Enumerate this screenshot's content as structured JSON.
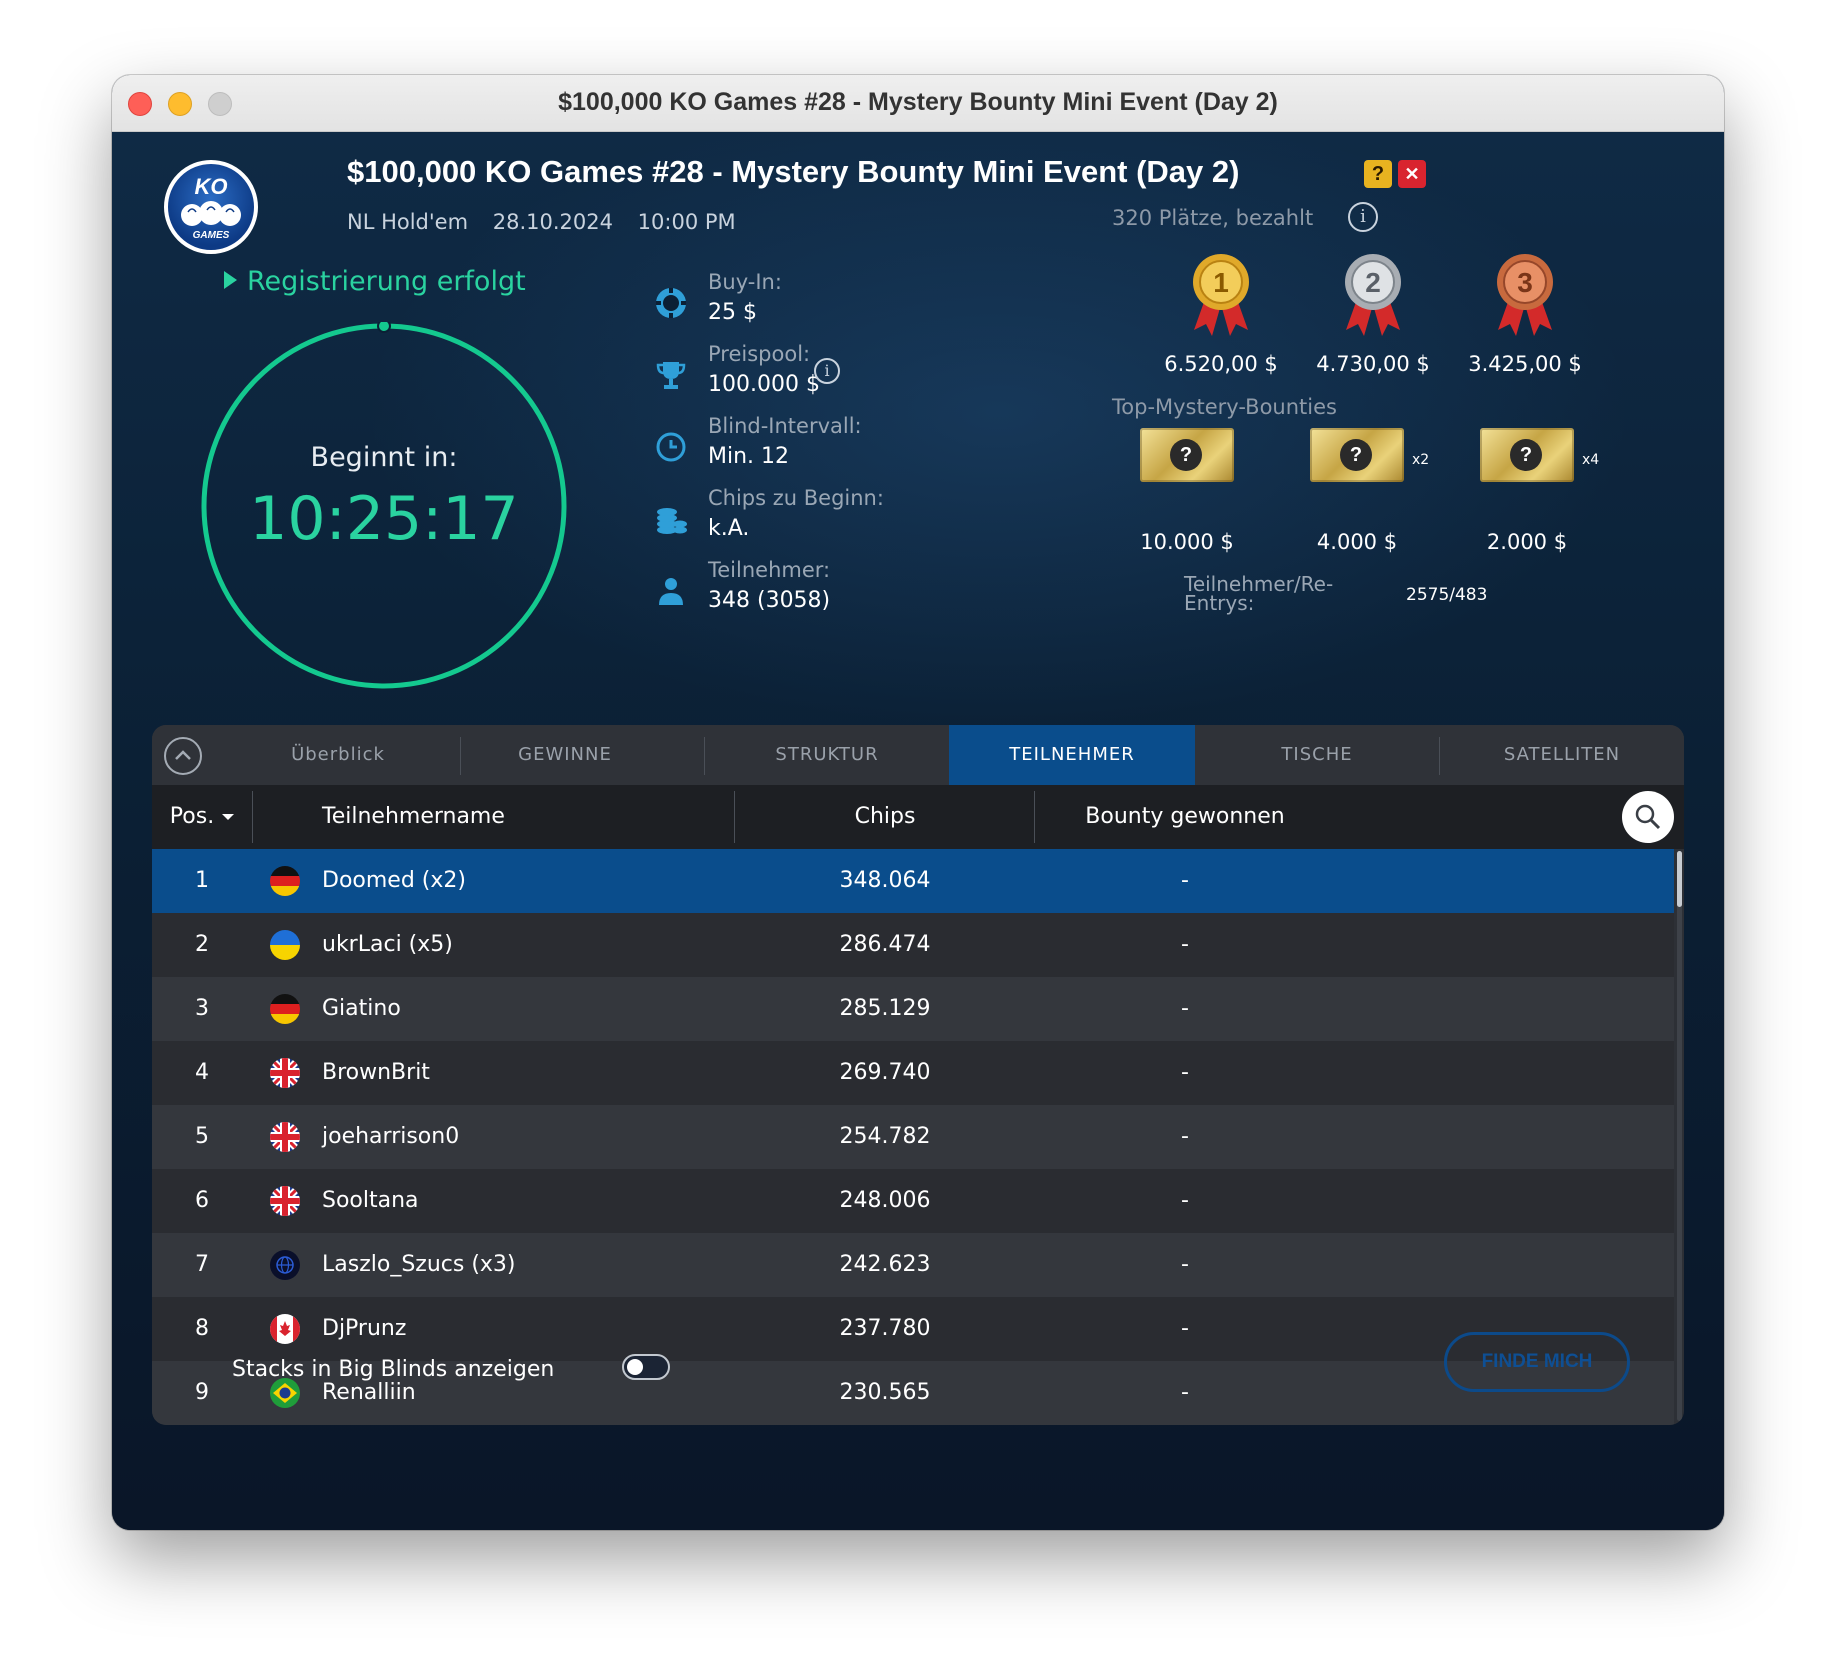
{
  "window": {
    "title": "$100,000 KO Games #28 - Mystery Bounty Mini Event (Day 2)"
  },
  "header": {
    "logo_text": "KO",
    "logo_subtext": "GAMES",
    "event_title": "$100,000 KO Games #28 - Mystery Bounty Mini Event (Day 2)",
    "badge_mystery": "?",
    "badge_ko": "✕",
    "game_type": "NL Hold'em",
    "date": "28.10.2024",
    "time": "10:00 PM",
    "places_paid": "320 Plätze, bezahlt"
  },
  "registration": {
    "status": "Registrierung erfolgt"
  },
  "timer": {
    "label": "Beginnt in:",
    "countdown": "10:25:17"
  },
  "info": {
    "buyin_label": "Buy-In:",
    "buyin_value": "25 $",
    "prizepool_label": "Preispool:",
    "prizepool_value": "100.000 $",
    "blind_label": "Blind-Intervall:",
    "blind_value": "Min. 12",
    "chips_label": "Chips zu Beginn:",
    "chips_value": "k.A.",
    "players_label": "Teilnehmer:",
    "players_value": "348 (3058)"
  },
  "prizes": {
    "medal_1": "1",
    "medal_2": "2",
    "medal_3": "3",
    "first": "6.520,00 $",
    "second": "4.730,00 $",
    "third": "3.425,00 $"
  },
  "bounties": {
    "label": "Top-Mystery-Bounties",
    "ticket_symbol": "?",
    "b1": "10.000 $",
    "b2": "4.000 $",
    "b2_mult": "x2",
    "b3": "2.000 $",
    "b3_mult": "x4"
  },
  "reentries": {
    "label": "Teilnehmer/Re-Entrys:",
    "value": "2575/483"
  },
  "tabs": [
    {
      "label": "Überblick"
    },
    {
      "label": "GEWINNE"
    },
    {
      "label": "STRUKTUR"
    },
    {
      "label": "TEILNEHMER"
    },
    {
      "label": "TISCHE"
    },
    {
      "label": "SATELLITEN"
    }
  ],
  "table": {
    "headers": {
      "pos": "Pos.",
      "name": "Teilnehmername",
      "chips": "Chips",
      "bounty": "Bounty gewonnen"
    },
    "rows": [
      {
        "pos": "1",
        "flag": "germany-flag",
        "name": "Doomed (x2)",
        "chips": "348.064",
        "bounty": "-"
      },
      {
        "pos": "2",
        "flag": "ukraine-flag",
        "name": "ukrLaci (x5)",
        "chips": "286.474",
        "bounty": "-"
      },
      {
        "pos": "3",
        "flag": "germany-flag",
        "name": "Giatino",
        "chips": "285.129",
        "bounty": "-"
      },
      {
        "pos": "4",
        "flag": "uk-flag",
        "name": "BrownBrit",
        "chips": "269.740",
        "bounty": "-"
      },
      {
        "pos": "5",
        "flag": "uk-flag",
        "name": "joeharrison0",
        "chips": "254.782",
        "bounty": "-"
      },
      {
        "pos": "6",
        "flag": "uk-flag",
        "name": "Sooltana",
        "chips": "248.006",
        "bounty": "-"
      },
      {
        "pos": "7",
        "flag": "world-flag",
        "name": "Laszlo_Szucs (x3)",
        "chips": "242.623",
        "bounty": "-"
      },
      {
        "pos": "8",
        "flag": "canada-flag",
        "name": "DjPrunz",
        "chips": "237.780",
        "bounty": "-"
      },
      {
        "pos": "9",
        "flag": "brazil-flag",
        "name": "Renalliin",
        "chips": "230.565",
        "bounty": "-"
      }
    ]
  },
  "footer": {
    "stacks_label": "Stacks in Big Blinds anzeigen",
    "stacks_toggle_on": false,
    "find_me": "FINDE MICH"
  },
  "colors": {
    "accent_green": "#2ad3a0",
    "active_tab": "#0a4d8c",
    "selected_row": "#0a4d8c"
  }
}
